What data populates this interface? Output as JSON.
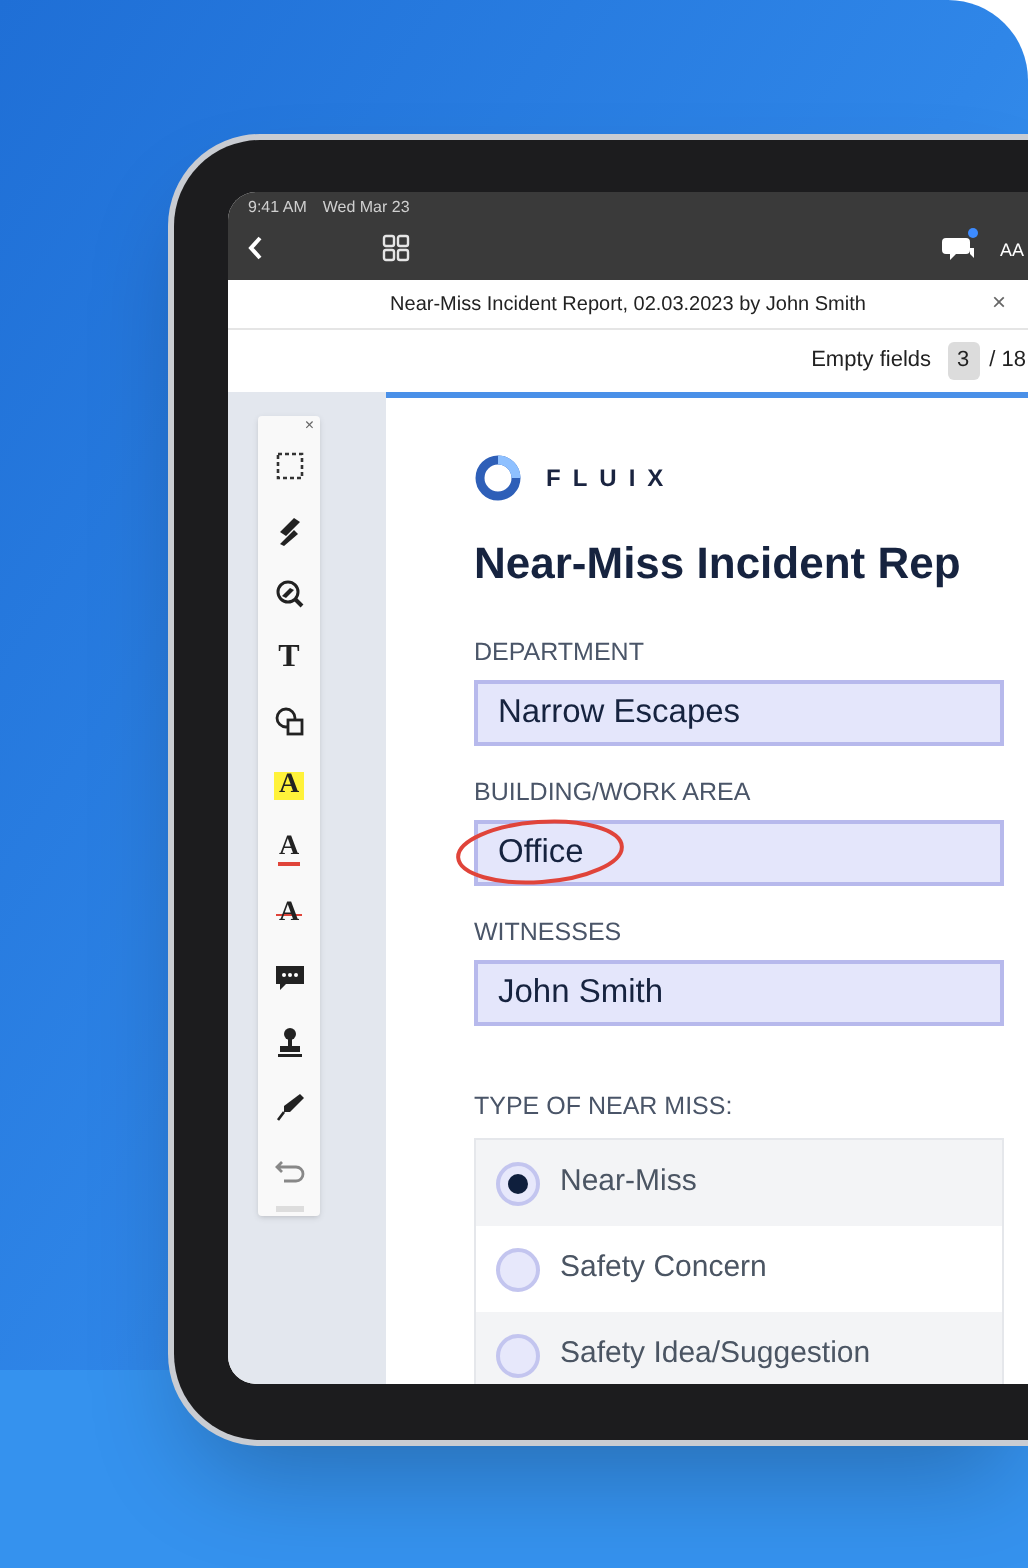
{
  "status_bar": {
    "time": "9:41 AM",
    "date": "Wed Mar 23"
  },
  "toolbar": {
    "comments_unread": true,
    "text_size_label": "AA"
  },
  "document_tab": {
    "title": "Near-Miss Incident Report, 02.03.2023 by John Smith",
    "close": "×"
  },
  "empty_fields": {
    "label": "Empty fields",
    "current": "3",
    "total": "/ 18"
  },
  "tools_panel": {
    "close": "×",
    "tools": [
      {
        "kind": "select"
      },
      {
        "kind": "pen"
      },
      {
        "kind": "eraser"
      },
      {
        "kind": "text",
        "glyph": "T"
      },
      {
        "kind": "shapes"
      },
      {
        "kind": "highlight",
        "glyph": "A"
      },
      {
        "kind": "underline",
        "glyph": "A"
      },
      {
        "kind": "strikeout",
        "glyph": "A"
      },
      {
        "kind": "comment"
      },
      {
        "kind": "stamp"
      },
      {
        "kind": "signature"
      },
      {
        "kind": "undo"
      }
    ]
  },
  "form": {
    "logo_text": "FLUIX",
    "heading": "Near-Miss Incident Rep",
    "fields": [
      {
        "label": "DEPARTMENT",
        "value": "Narrow Escapes",
        "circled": false
      },
      {
        "label": "BUILDING/WORK AREA",
        "value": "Office",
        "circled": true
      },
      {
        "label": "WITNESSES",
        "value": "John Smith",
        "circled": false
      }
    ],
    "type_label": "TYPE OF NEAR MISS:",
    "options": [
      {
        "label": "Near-Miss",
        "selected": true
      },
      {
        "label": "Safety Concern",
        "selected": false
      },
      {
        "label": "Safety Idea/Suggestion",
        "selected": false
      }
    ]
  }
}
